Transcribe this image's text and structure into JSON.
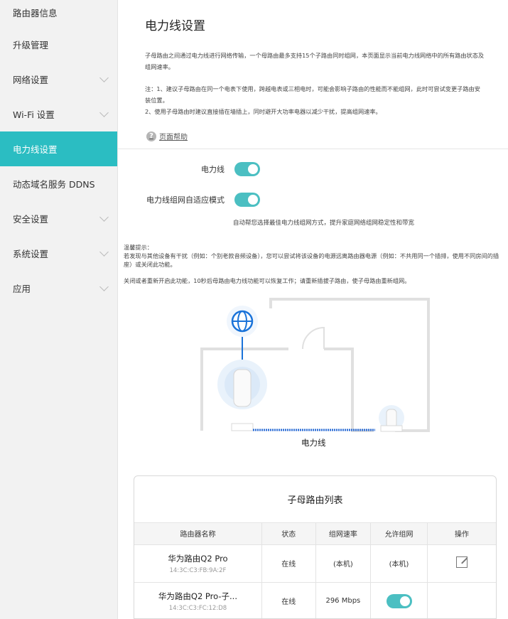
{
  "sidebar": {
    "items": [
      {
        "label": "路由器信息",
        "expandable": false,
        "active": false
      },
      {
        "label": "升级管理",
        "expandable": false,
        "active": false
      },
      {
        "label": "网络设置",
        "expandable": true,
        "active": false
      },
      {
        "label": "Wi-Fi 设置",
        "expandable": true,
        "active": false
      },
      {
        "label": "电力线设置",
        "expandable": false,
        "active": true
      },
      {
        "label": "动态域名服务 DDNS",
        "expandable": false,
        "active": false
      },
      {
        "label": "安全设置",
        "expandable": true,
        "active": false
      },
      {
        "label": "系统设置",
        "expandable": true,
        "active": false
      },
      {
        "label": "应用",
        "expandable": true,
        "active": false
      }
    ]
  },
  "main": {
    "title": "电力线设置",
    "intro": "子母路由之间通过电力线进行网络传输，一个母路由最多支持15个子路由同时组网，本页面显示当前电力线网络中的所有路由状态及组网速率。",
    "note_1": "注：1、建议子母路由在同一个电表下使用，跨越电表或三相电时，可能会影响子路由的性能而不能组网，此时可尝试变更子路由安装位置。",
    "note_2": "2、使用子母路由时建议直接插在墙插上，同时避开大功率电器以减少干扰，提高组网速率。",
    "help_link": "页面帮助",
    "help_icon": "?",
    "powerline_label": "电力线",
    "powerline_on": true,
    "adaptive_label": "电力线组网自适应模式",
    "adaptive_on": true,
    "adaptive_hint": "自动帮您选择最佳电力线组网方式，提升家庭网络组网稳定性和带宽",
    "tips_title": "温馨提示：",
    "tips_1": "若发现与其他设备有干扰（例如：个别老款音频设备），您可以尝试将该设备的电源远离路由器电源（例如：不共用同一个插排，使用不同房间的插座）或关闭此功能。",
    "tips_2": "关闭或者重新开启此功能，10秒后母路由电力线功能可以恢复工作；请重新插拔子路由，使子母路由重新组网。",
    "illustration_caption": "电力线"
  },
  "router_list": {
    "title": "子母路由列表",
    "columns": [
      "路由器名称",
      "状态",
      "组网速率",
      "允许组网",
      "操作"
    ],
    "rows": [
      {
        "name": "华为路由Q2 Pro",
        "mac": "14:3C:C3:FB:9A:2F",
        "status": "在线",
        "rate": "(本机)",
        "allow": "(本机)"
      },
      {
        "name": "华为路由Q2 Pro-子...",
        "mac": "14:3C:C3:FC:12:D8",
        "status": "在线",
        "rate": "296 Mbps",
        "allow_toggle_on": true
      }
    ]
  },
  "colors": {
    "accent": "#2bbdc2",
    "toggle": "#4bbfc2",
    "globe": "#1a73d9",
    "powerline": "#2f6fd6"
  },
  "icons": [
    "chevron-down-icon",
    "help-icon",
    "globe-icon",
    "router-icon",
    "edit-icon"
  ]
}
